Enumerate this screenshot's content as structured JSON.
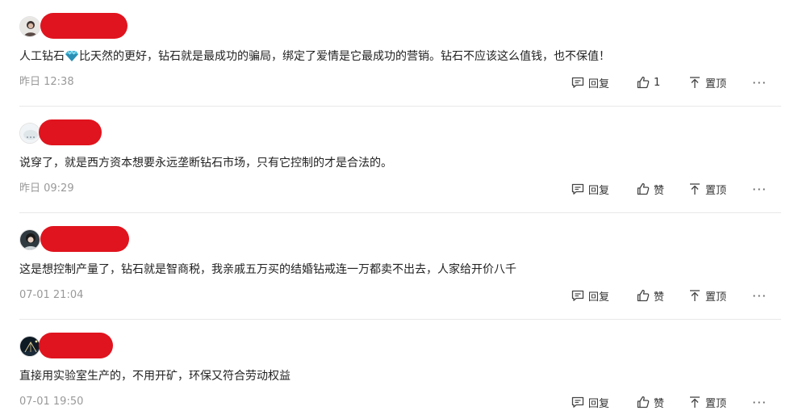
{
  "comments": [
    {
      "text_before": "人工钻石",
      "text_after": "比天然的更好，钻石就是最成功的骗局，绑定了爱情是它最成功的营销。钻石不应该这么值钱，也不保值！",
      "time": "昨日 12:38",
      "reply_label": "回复",
      "like_label": "1",
      "pin_label": "置顶",
      "more_label": "···"
    },
    {
      "text": "说穿了，就是西方资本想要永远垄断钻石市场，只有它控制的才是合法的。",
      "time": "昨日 09:29",
      "reply_label": "回复",
      "like_label": "赞",
      "pin_label": "置顶",
      "more_label": "···"
    },
    {
      "text": "这是想控制产量了，钻石就是智商税，我亲戚五万买的结婚钻戒连一万都卖不出去，人家给开价八千",
      "time": "07-01 21:04",
      "reply_label": "回复",
      "like_label": "赞",
      "pin_label": "置顶",
      "more_label": "···"
    },
    {
      "text": "直接用实验室生产的，不用开矿，环保又符合劳动权益",
      "time": "07-01 19:50",
      "reply_label": "回复",
      "like_label": "赞",
      "pin_label": "置顶",
      "more_label": "···"
    }
  ],
  "colors": {
    "redaction": "#e0141e",
    "text": "#222222",
    "meta": "#999999",
    "action": "#333333",
    "divider": "#e8e8e8"
  },
  "icons": {
    "reply": "reply-icon",
    "like": "thumbs-up-icon",
    "pin": "pin-to-top-icon",
    "more": "more-icon",
    "gem": "gem-emoji-icon"
  }
}
